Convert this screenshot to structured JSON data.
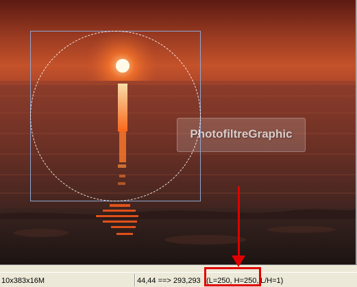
{
  "canvas": {
    "watermark": "PhotofiltreGraphic",
    "selection_shape": "circle"
  },
  "statusbar": {
    "image_info": "10x383x16M",
    "coords": "44,44 ==> 293,293",
    "size": "(L=250, H=250,",
    "ratio": "L/H=1)"
  },
  "annotation": {
    "highlight_color": "#e00000"
  }
}
